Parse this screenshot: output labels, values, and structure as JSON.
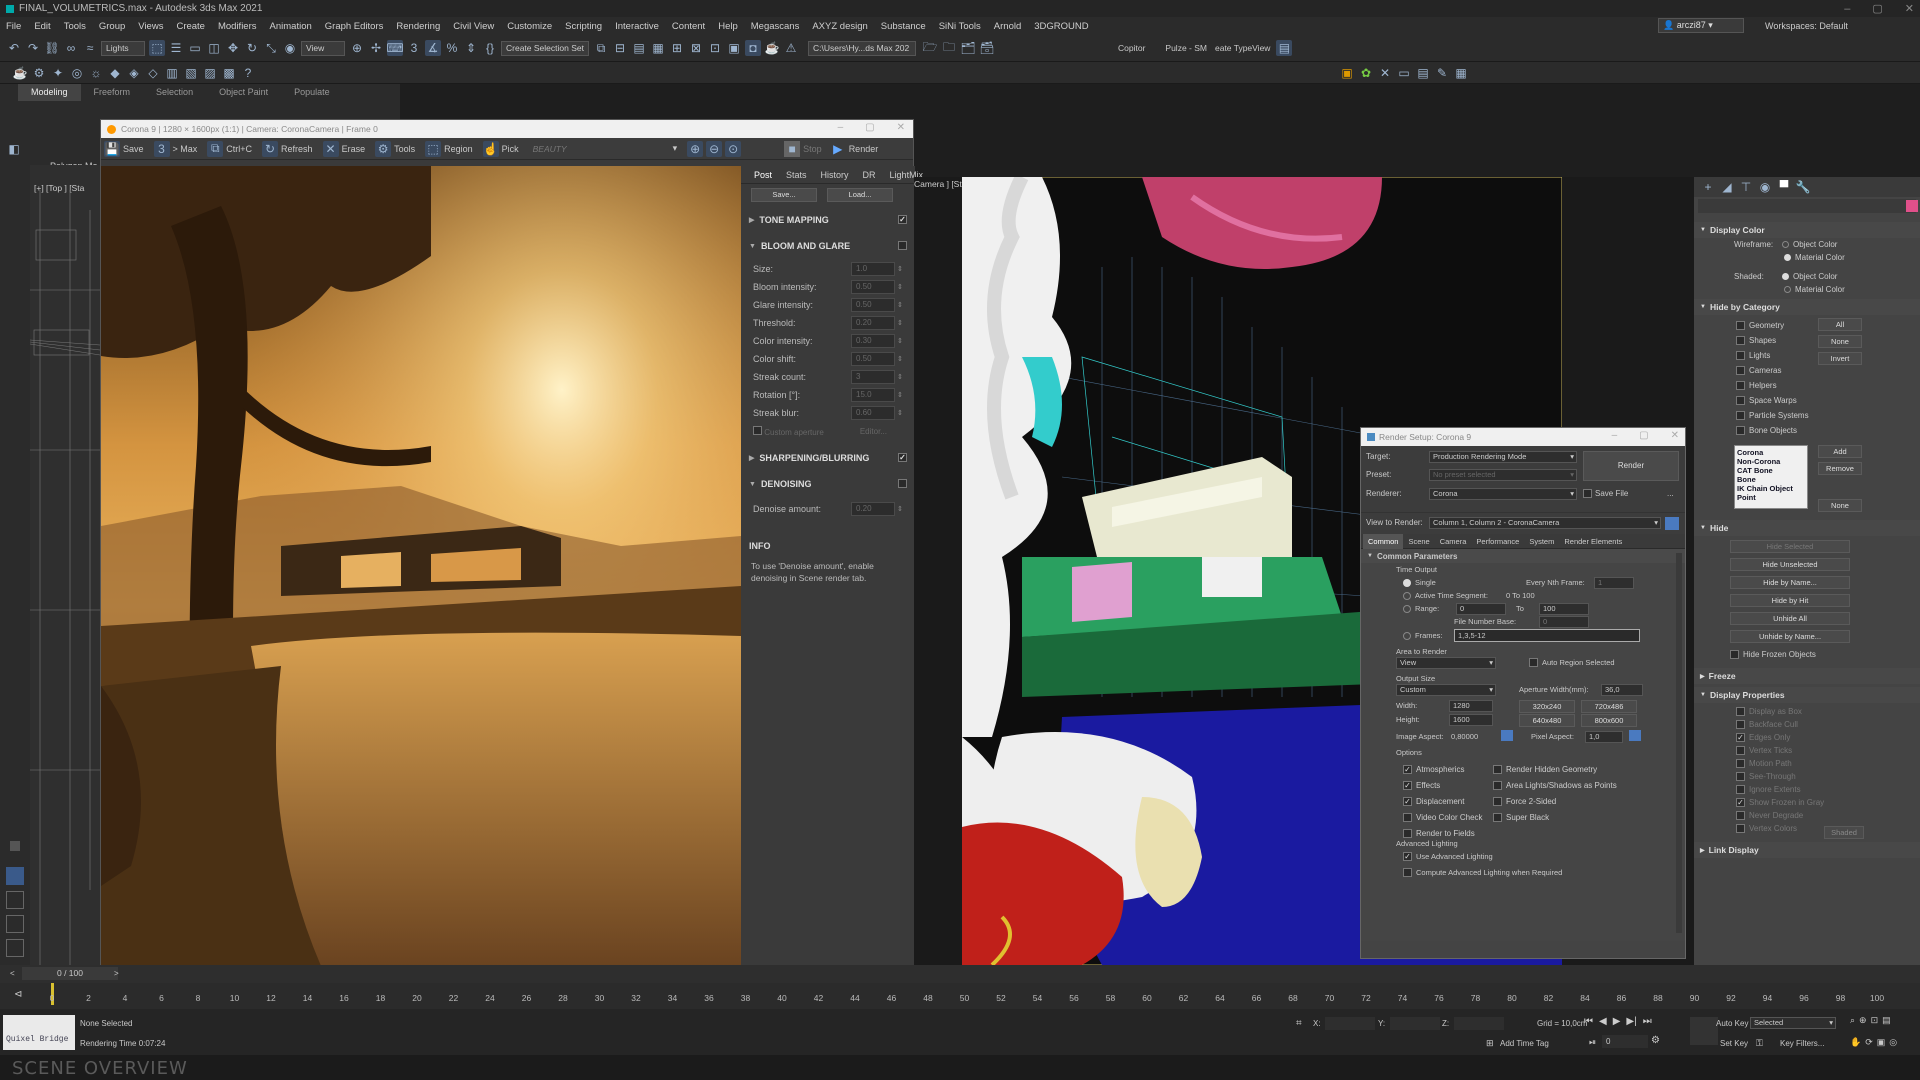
{
  "app": {
    "title": "FINAL_VOLUMETRICS.max - Autodesk 3ds Max 2021"
  },
  "menu": [
    "File",
    "Edit",
    "Tools",
    "Group",
    "Views",
    "Create",
    "Modifiers",
    "Animation",
    "Graph Editors",
    "Rendering",
    "Civil View",
    "Customize",
    "Scripting",
    "Interactive",
    "Content",
    "Help",
    "Megascans",
    "AXYZ design",
    "Substance",
    "SiNi Tools",
    "Arnold",
    "3DGROUND"
  ],
  "user": "arczi87",
  "workspaces": "Workspaces: Default",
  "toolbar": {
    "lights": "Lights",
    "view": "View",
    "selection_set": "Create Selection Set",
    "path": "C:\\Users\\Hy...ds Max 202",
    "copitor": "Copitor",
    "pulze": "Pulze - SM",
    "typeview": "eate TypeView"
  },
  "ribbon_tabs": [
    "Modeling",
    "Freeform",
    "Selection",
    "Object Paint",
    "Populate"
  ],
  "viewport_label": "[+] [Top ] [Sta",
  "polygon_label": "Polygon Mo",
  "vfb": {
    "title": "Corona 9 | 1280 × 1600px (1:1) | Camera: CoronaCamera | Frame 0",
    "toolbar": {
      "save": "Save",
      "max": "> Max",
      "ctrlc": "Ctrl+C",
      "refresh": "Refresh",
      "erase": "Erase",
      "tools": "Tools",
      "region": "Region",
      "pick": "Pick",
      "beauty": "BEAUTY",
      "stop": "Stop",
      "render": "Render"
    },
    "tabs": [
      "Post",
      "Stats",
      "History",
      "DR",
      "LightMix"
    ],
    "save_btn": "Save...",
    "load_btn": "Load...",
    "tone_mapping": "TONE MAPPING",
    "bloom": "BLOOM AND GLARE",
    "params": [
      {
        "label": "Size:",
        "value": "1.0"
      },
      {
        "label": "Bloom intensity:",
        "value": "0.50"
      },
      {
        "label": "Glare intensity:",
        "value": "0.50"
      },
      {
        "label": "Threshold:",
        "value": "0.20"
      },
      {
        "label": "Color intensity:",
        "value": "0.30"
      },
      {
        "label": "Color shift:",
        "value": "0.50"
      },
      {
        "label": "Streak count:",
        "value": "3"
      },
      {
        "label": "Rotation [°]:",
        "value": "15.0"
      },
      {
        "label": "Streak blur:",
        "value": "0.60"
      }
    ],
    "custom_aperture": "Custom aperture",
    "editor": "Editor...",
    "sharpening": "SHARPENING/BLURRING",
    "denoising": "DENOISING",
    "denoise_label": "Denoise amount:",
    "denoise_value": "0.20",
    "info_title": "INFO",
    "info_text": "To use 'Denoise amount', enable denoising in Scene render tab."
  },
  "camera_label": "Camera ] [St",
  "render_setup": {
    "title": "Render Setup: Corona 9",
    "target_label": "Target:",
    "target": "Production Rendering Mode",
    "preset_label": "Preset:",
    "preset": "No preset selected",
    "renderer_label": "Renderer:",
    "renderer": "Corona",
    "save_file": "Save File",
    "render_btn": "Render",
    "view_label": "View to Render:",
    "view": "Column 1, Column 2 - CoronaCamera",
    "tabs": [
      "Common",
      "Scene",
      "Camera",
      "Performance",
      "System",
      "Render Elements"
    ],
    "common_params": "Common Parameters",
    "time_output": "Time Output",
    "single": "Single",
    "every_nth": "Every Nth Frame:",
    "nth_value": "1",
    "active_seg": "Active Time Segment:",
    "seg_value": "0 To 100",
    "range": "Range:",
    "range_from": "0",
    "range_to_label": "To",
    "range_to": "100",
    "file_base": "File Number Base:",
    "file_base_value": "0",
    "frames": "Frames:",
    "frames_value": "1,3,5-12",
    "area": "Area to Render",
    "area_value": "View",
    "auto_region": "Auto Region Selected",
    "output_size": "Output Size",
    "size_preset": "Custom",
    "aperture": "Aperture Width(mm):",
    "aperture_value": "36,0",
    "width_label": "Width:",
    "width": "1280",
    "height_label": "Height:",
    "height": "1600",
    "presets": [
      "320x240",
      "720x486",
      "640x480",
      "800x600"
    ],
    "image_aspect": "Image Aspect:",
    "image_aspect_value": "0,80000",
    "pixel_aspect": "Pixel Aspect:",
    "pixel_aspect_value": "1,0",
    "options": "Options",
    "opts_left": [
      "Atmospherics",
      "Effects",
      "Displacement",
      "Video Color Check",
      "Render to Fields"
    ],
    "opts_left_checked": [
      true,
      true,
      true,
      false,
      false
    ],
    "opts_right": [
      "Render Hidden Geometry",
      "Area Lights/Shadows as Points",
      "Force 2-Sided",
      "Super Black"
    ],
    "adv_lighting": "Advanced Lighting",
    "use_adv": "Use Advanced Lighting",
    "compute_adv": "Compute Advanced Lighting when Required"
  },
  "command_panel": {
    "display_color": "Display Color",
    "wireframe": "Wireframe:",
    "shaded": "Shaded:",
    "object_color": "Object Color",
    "material_color": "Material Color",
    "hide_by_category": "Hide by Category",
    "categories": [
      "Geometry",
      "Shapes",
      "Lights",
      "Cameras",
      "Helpers",
      "Space Warps",
      "Particle Systems",
      "Bone Objects"
    ],
    "cat_buttons": [
      "All",
      "None",
      "Invert"
    ],
    "list_items": [
      "Corona",
      "Non-Corona",
      "CAT Bone",
      "Bone",
      "IK Chain Object",
      "Point"
    ],
    "list_buttons": [
      "Add",
      "Remove",
      "None"
    ],
    "hide": "Hide",
    "hide_buttons": [
      "Hide Selected",
      "Hide Unselected",
      "Hide by Name...",
      "Hide by Hit",
      "Unhide All",
      "Unhide by Name...",
      "Hide Frozen Objects"
    ],
    "freeze": "Freeze",
    "display_props": "Display Properties",
    "props": [
      "Display as Box",
      "Backface Cull",
      "Edges Only",
      "Vertex Ticks",
      "Motion Path",
      "See-Through",
      "Ignore Extents",
      "Show Frozen in Gray",
      "Never Degrade",
      "Vertex Colors"
    ],
    "shaded_btn": "Shaded",
    "link_display": "Link Display"
  },
  "timeline": {
    "frame": "0 / 100",
    "ticks": [
      "0",
      "2",
      "4",
      "6",
      "8",
      "10",
      "12",
      "14",
      "16",
      "18",
      "20",
      "22",
      "24",
      "26",
      "28",
      "30",
      "32",
      "34",
      "36",
      "38",
      "40",
      "42",
      "44",
      "46",
      "48",
      "50",
      "52",
      "54",
      "56",
      "58",
      "60",
      "62",
      "64",
      "66",
      "68",
      "70",
      "72",
      "74",
      "76",
      "78",
      "80",
      "82",
      "84",
      "86",
      "88",
      "90",
      "92",
      "94",
      "96",
      "98",
      "100"
    ]
  },
  "status": {
    "quixel": "Quixel Bridge",
    "none_selected": "None Selected",
    "render_time": "Rendering Time  0:07:24",
    "x": "X:",
    "y": "Y:",
    "z": "Z:",
    "grid": "Grid = 10,0cm",
    "add_time_tag": "Add Time Tag",
    "auto_key": "Auto Key",
    "selected": "Selected",
    "set_key": "Set Key",
    "key_filters": "Key Filters...",
    "frame_value": "0"
  },
  "overlay": "SCENE OVERVIEW"
}
